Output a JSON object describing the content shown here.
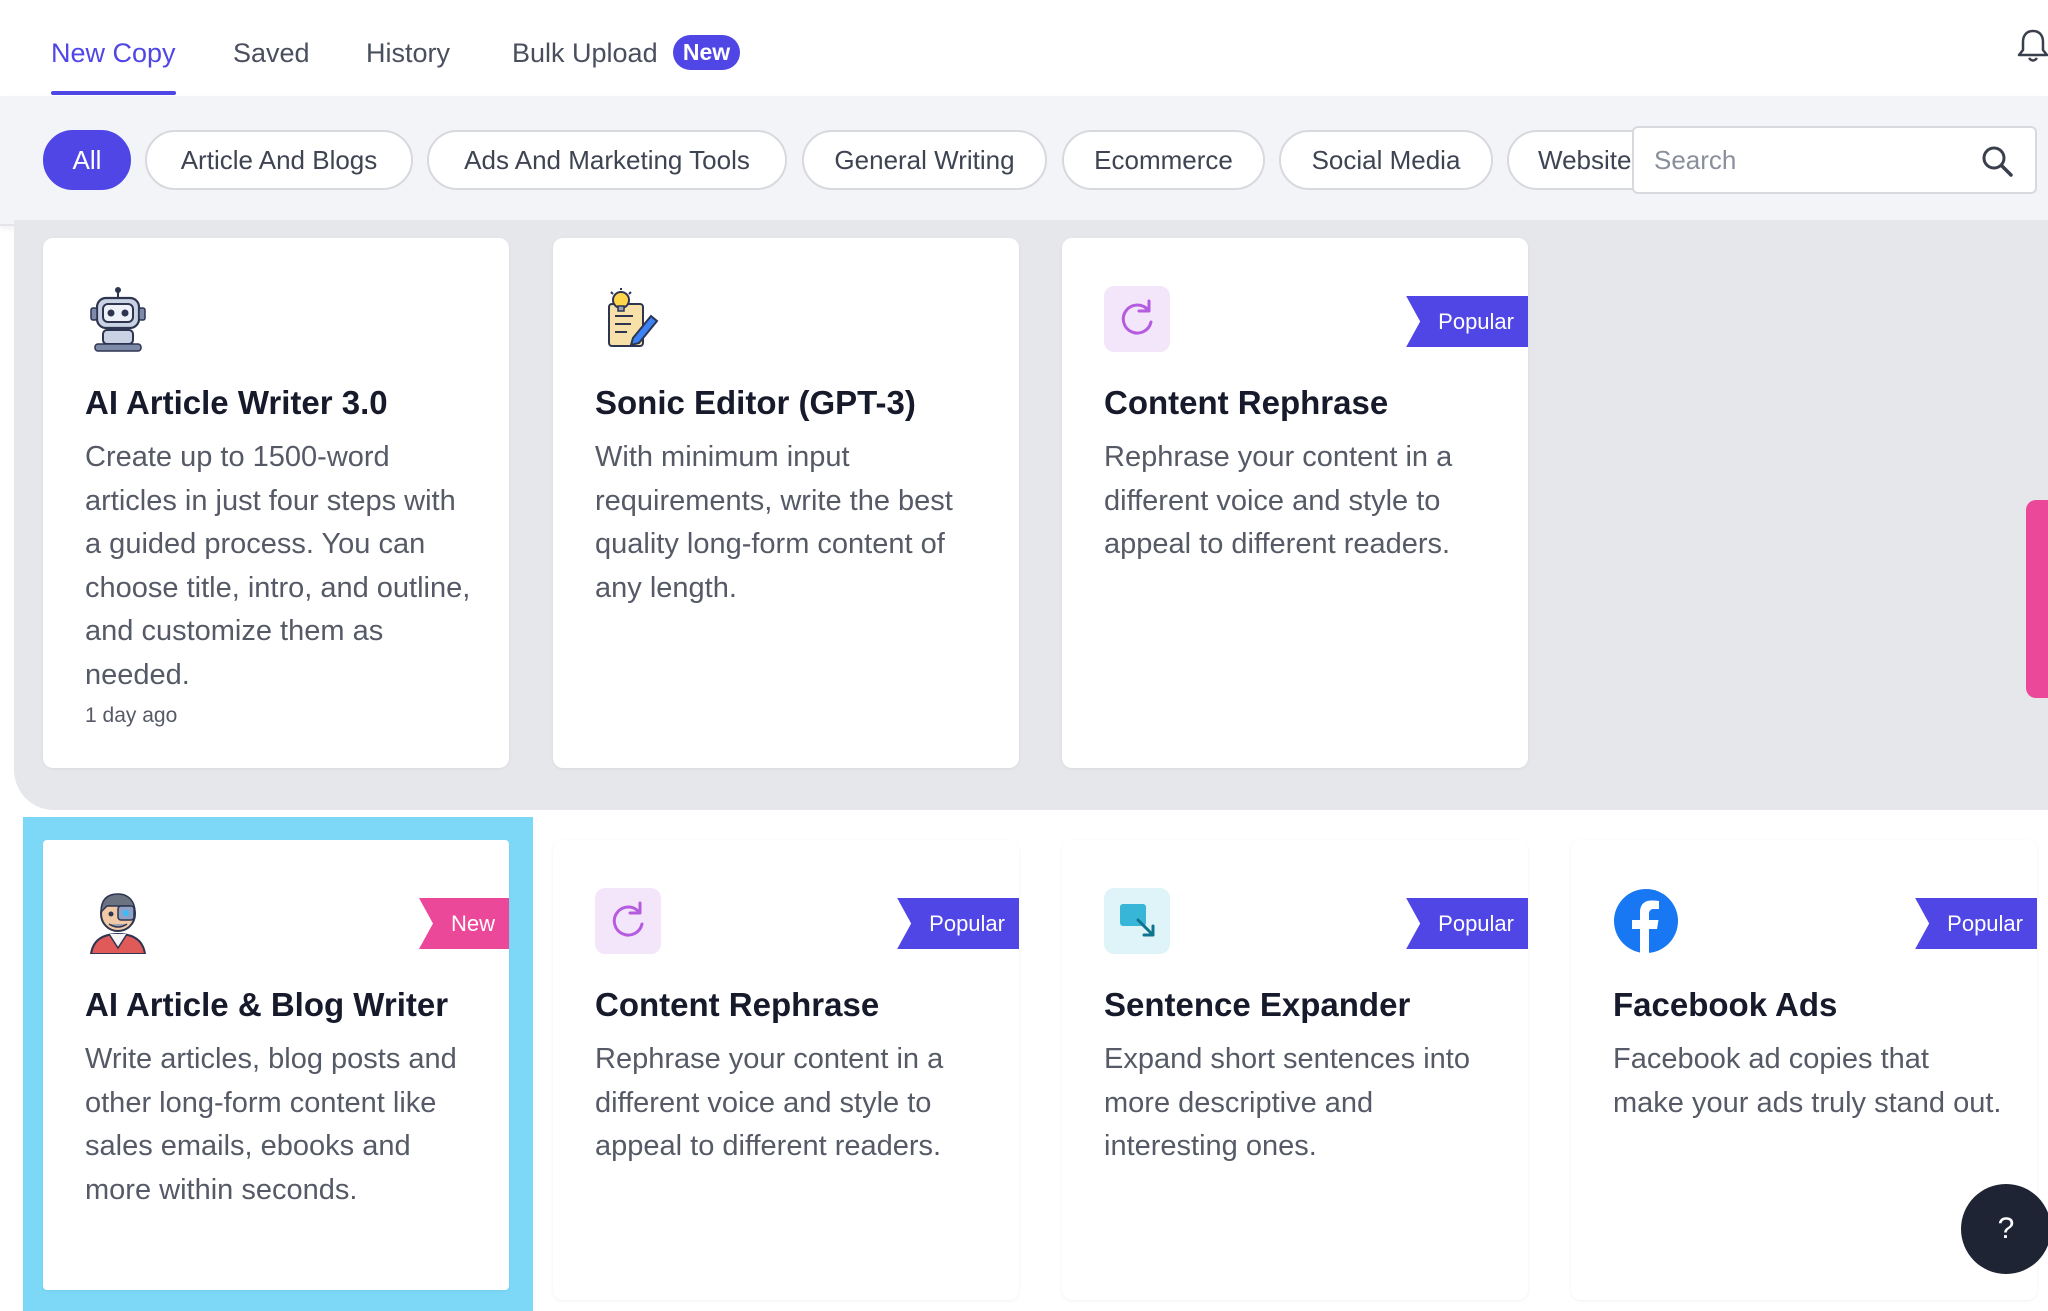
{
  "tabs": [
    {
      "label": "New Copy"
    },
    {
      "label": "Saved"
    },
    {
      "label": "History"
    },
    {
      "label": "Bulk Upload",
      "badge": "New"
    }
  ],
  "filters": [
    {
      "label": "All"
    },
    {
      "label": "Article And Blogs"
    },
    {
      "label": "Ads And Marketing Tools"
    },
    {
      "label": "General Writing"
    },
    {
      "label": "Ecommerce"
    },
    {
      "label": "Social Media"
    },
    {
      "label": "Website"
    }
  ],
  "search": {
    "placeholder": "Search"
  },
  "recent_cards": [
    {
      "title": "AI Article Writer 3.0",
      "desc": "Create up to 1500-word articles in just four steps with a guided process. You can choose title, intro, and outline, and customize them as needed.",
      "time": "1 day ago",
      "icon": "robot-icon"
    },
    {
      "title": "Sonic Editor (GPT-3)",
      "desc": "With minimum input requirements, write the best quality long-form content of any length.",
      "icon": "notepad-lightbulb-icon"
    },
    {
      "title": "Content Rephrase",
      "desc": "Rephrase your content in a different voice and style to appeal to different readers.",
      "badge": "Popular",
      "icon": "refresh-icon"
    }
  ],
  "tool_cards": [
    {
      "title": "AI Article & Blog Writer",
      "desc": "Write articles, blog posts and other long-form content like sales emails, ebooks and more within seconds.",
      "badge": "New",
      "icon": "cyborg-icon"
    },
    {
      "title": "Content Rephrase",
      "desc": "Rephrase your content in a different voice and style to appeal to different readers.",
      "badge": "Popular",
      "icon": "refresh-icon"
    },
    {
      "title": "Sentence Expander",
      "desc": "Expand short sentences into more descriptive and interesting ones.",
      "badge": "Popular",
      "icon": "expand-icon"
    },
    {
      "title": "Facebook Ads",
      "desc": "Facebook ad copies that make your ads truly stand out.",
      "badge": "Popular",
      "icon": "facebook-icon"
    }
  ],
  "help": {
    "label": "?"
  },
  "colors": {
    "accent": "#4f46e5",
    "new_badge": "#ec4899",
    "highlight": "#7dd8f7"
  }
}
